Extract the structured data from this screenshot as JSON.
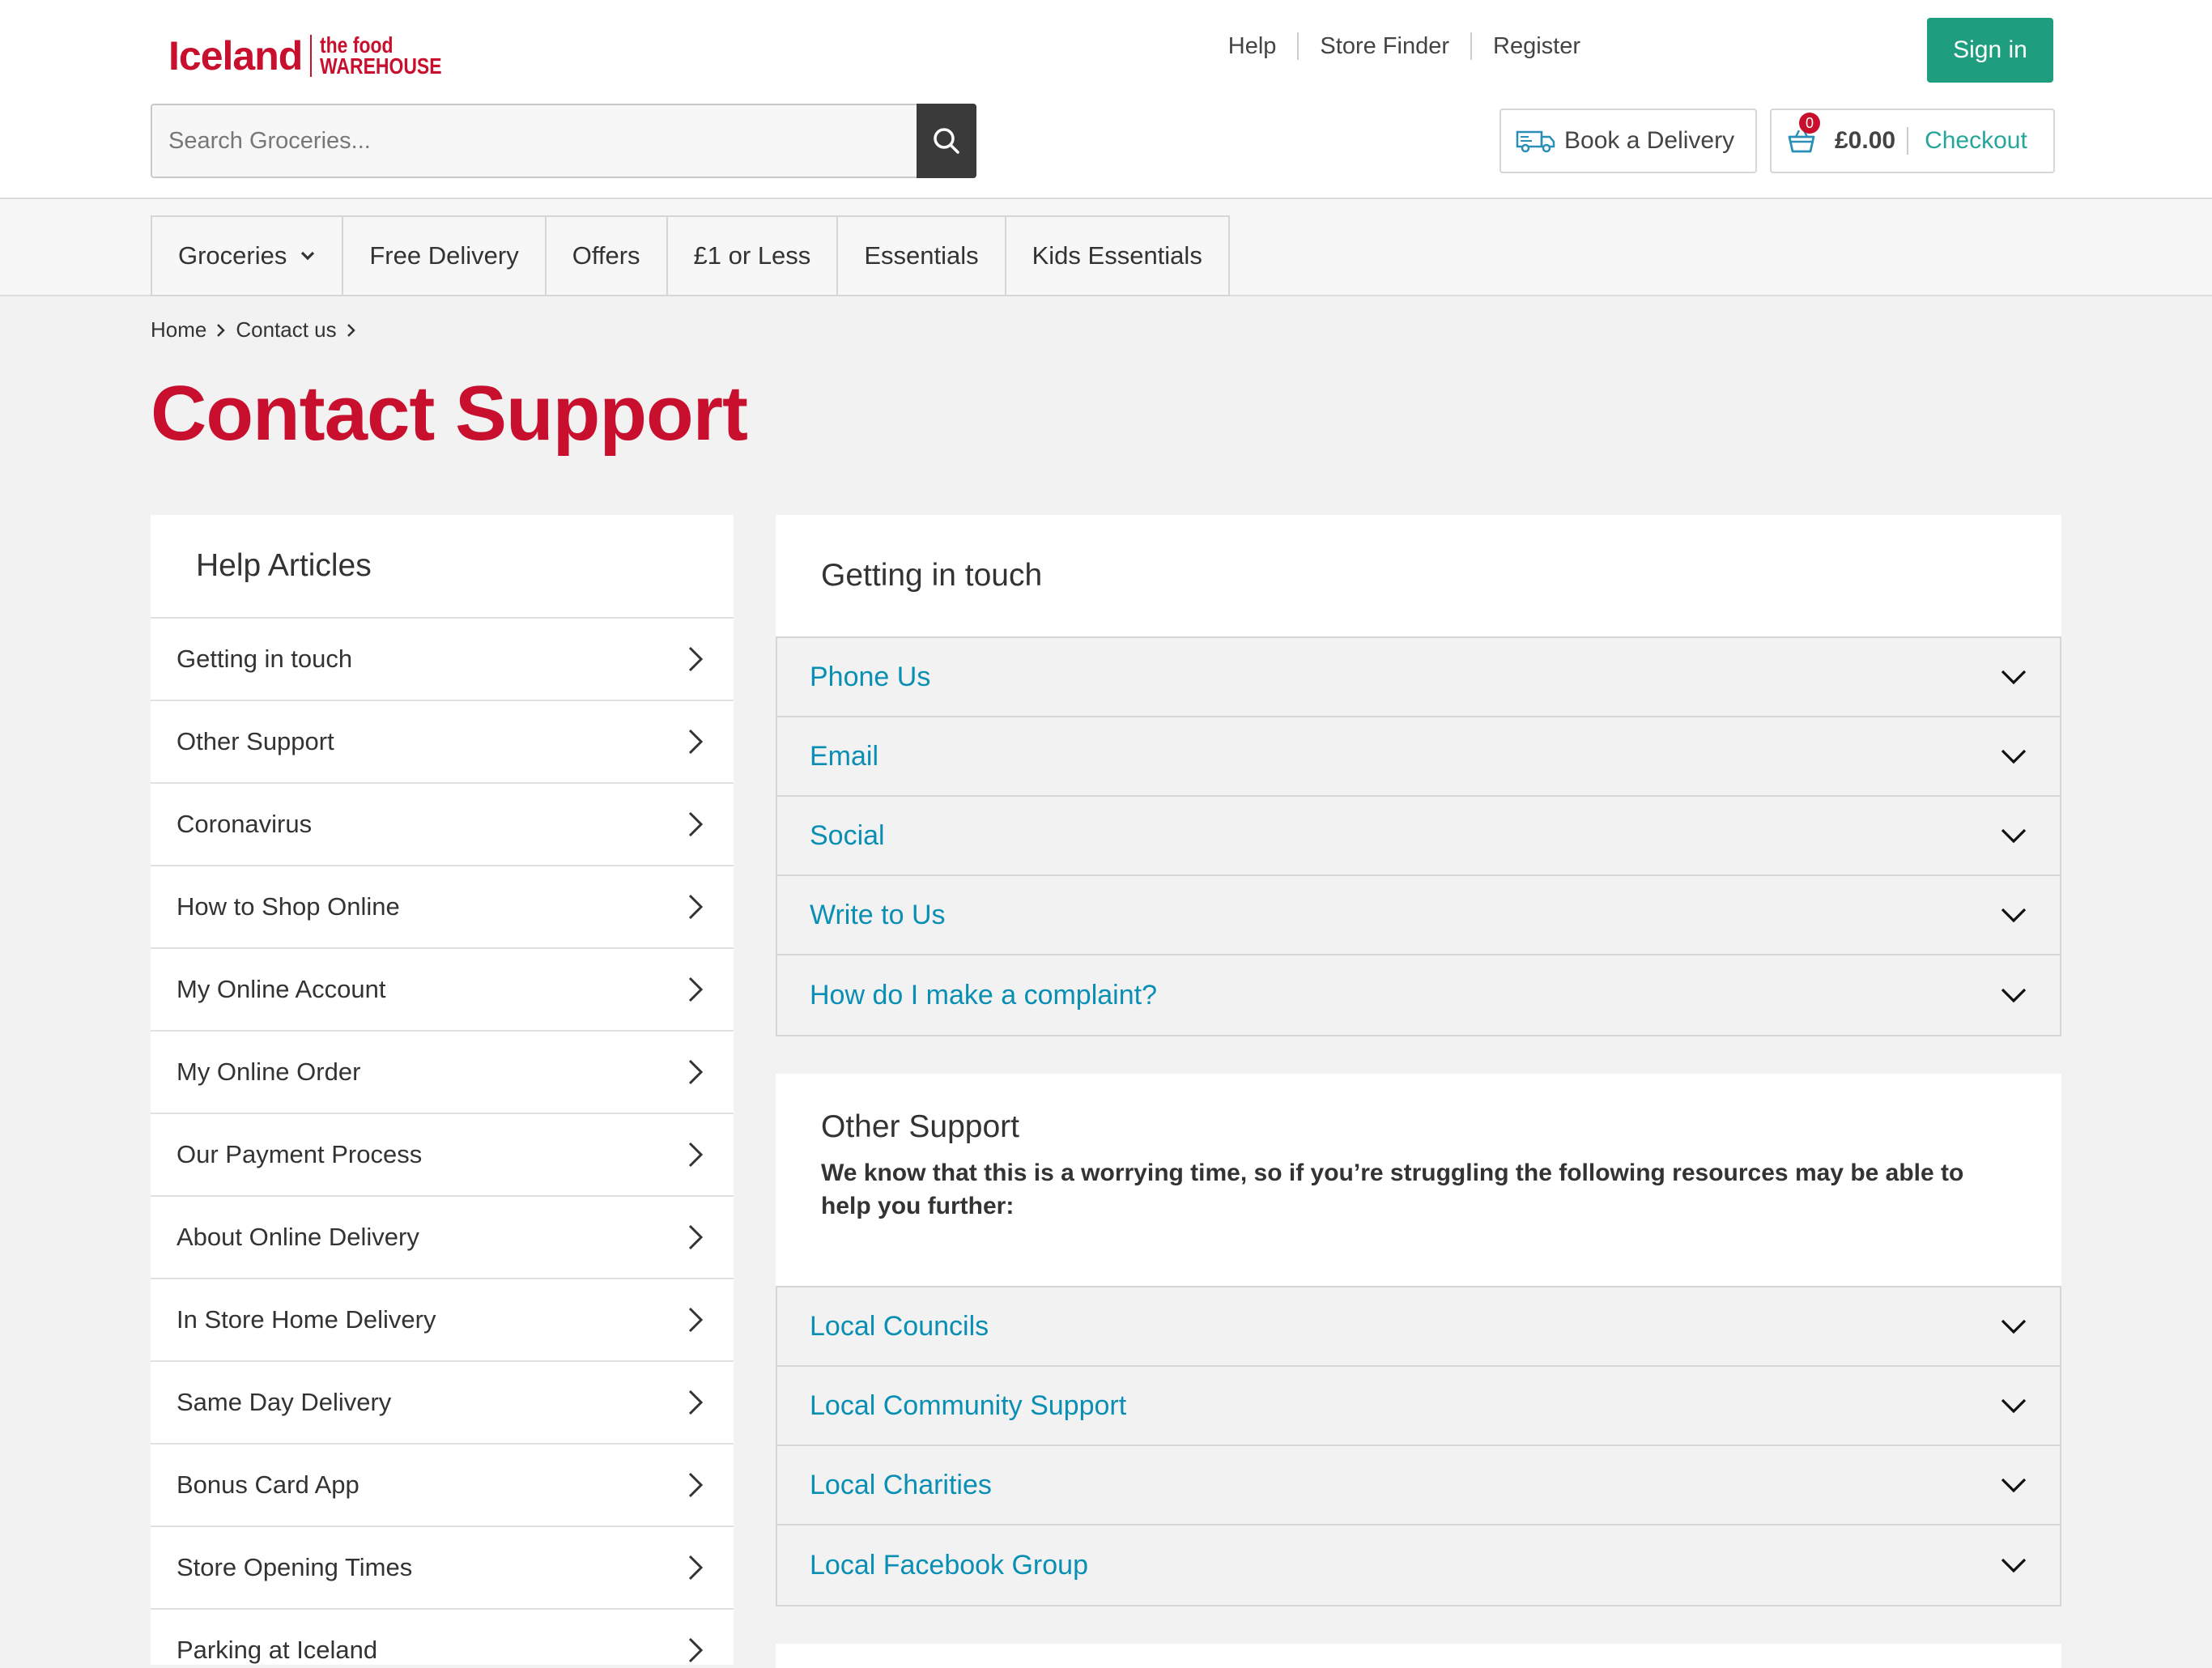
{
  "brand": {
    "name": "Iceland",
    "partner_line1": "the food",
    "partner_line2": "WAREHOUSE",
    "color": "#c8102e"
  },
  "header": {
    "links": [
      "Help",
      "Store Finder",
      "Register"
    ],
    "signin_label": "Sign in",
    "search_placeholder": "Search Groceries...",
    "delivery_label": "Book a Delivery",
    "basket_count": "0",
    "basket_total": "£0.00",
    "checkout_label": "Checkout"
  },
  "nav": {
    "items": [
      "Groceries",
      "Free Delivery",
      "Offers",
      "£1 or Less",
      "Essentials",
      "Kids Essentials"
    ]
  },
  "breadcrumb": [
    "Home",
    "Contact us"
  ],
  "page_title": "Contact Support",
  "sidebar": {
    "title": "Help Articles",
    "items": [
      "Getting in touch",
      "Other Support",
      "Coronavirus",
      "How to Shop Online",
      "My Online Account",
      "My Online Order",
      "Our Payment Process",
      "About Online Delivery",
      "In Store Home Delivery",
      "Same Day Delivery",
      "Bonus Card App",
      "Store Opening Times",
      "Parking at Iceland"
    ]
  },
  "getting_in_touch": {
    "title": "Getting in touch",
    "items": [
      "Phone Us",
      "Email",
      "Social",
      "Write to Us",
      "How do I make a complaint?"
    ]
  },
  "other_support": {
    "title": "Other Support",
    "description": "We know that this is a worrying time, so if you’re struggling the following resources may be able to help you further:",
    "items": [
      "Local Councils",
      "Local Community Support",
      "Local Charities",
      "Local Facebook Group"
    ]
  },
  "colors": {
    "accent_green": "#1e9e7e",
    "link_blue": "#0a8fb4",
    "checkout_teal": "#26a69a"
  }
}
